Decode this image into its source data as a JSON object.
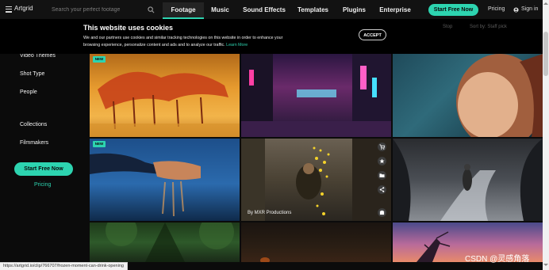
{
  "topnav": {
    "brand": "Artgrid",
    "search_placeholder": "Search your perfect footage",
    "tabs": [
      "Footage",
      "Music",
      "Sound Effects",
      "Templates",
      "Plugins",
      "Enterprise"
    ],
    "active_tab": "Footage",
    "cta_label": "Start Free Now",
    "pricing_label": "Pricing",
    "signin_label": "Sign in"
  },
  "sidebar": {
    "items": [
      "Video Themes",
      "Shot Type",
      "People",
      "Collections",
      "Filmmakers"
    ],
    "cta_label": "Start Free Now",
    "pricing_label": "Pricing"
  },
  "cookie": {
    "title": "This website uses cookies",
    "text": "We and our partners use cookies and similar tracking technologies on this website in order to enhance your browsing experience, personalize content and ads and to analyze our traffic.",
    "learn_more": "Learn More",
    "accept_label": "ACCEPT",
    "ghost_left": "Stop",
    "ghost_right": "Sort by: Staff pick"
  },
  "tiles": {
    "badge_new": "NEW",
    "credit": "By MXR Productions"
  },
  "status_url": "https://artgrid.io/clip/766707/frozen-moment-can-drink-opening",
  "watermark": "CSDN @灵感角落",
  "colors": {
    "accent": "#2dd4b0",
    "background": "#0b0b0b",
    "nav": "#121212"
  },
  "icons": [
    "menu-icon",
    "search-icon",
    "user-icon",
    "cart-icon",
    "star-icon",
    "folder-icon",
    "share-icon",
    "download-icon"
  ]
}
